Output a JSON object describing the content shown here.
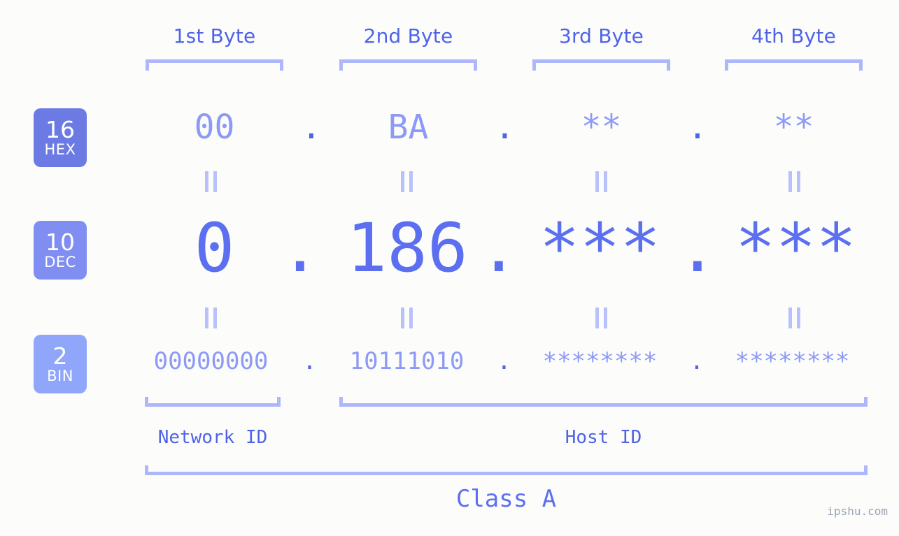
{
  "meta": {
    "background_color": "#fcfdfa",
    "accent_color": "#5c6ff0",
    "light_accent_color": "#aeb7fb"
  },
  "byte_headers": [
    {
      "label": "1st Byte"
    },
    {
      "label": "2nd Byte"
    },
    {
      "label": "3rd Byte"
    },
    {
      "label": "4th Byte"
    }
  ],
  "bases": [
    {
      "number": "16",
      "name": "HEX",
      "color": "#6c7ae3"
    },
    {
      "number": "10",
      "name": "DEC",
      "color": "#808ef2"
    },
    {
      "number": "2",
      "name": "BIN",
      "color": "#8fa6fb"
    }
  ],
  "rows": {
    "hex": {
      "base_number": "16",
      "base_name": "HEX",
      "values": [
        "00",
        "BA",
        "**",
        "**"
      ],
      "separator": "."
    },
    "dec": {
      "base_number": "10",
      "base_name": "DEC",
      "values": [
        "0",
        "186",
        "***",
        "***"
      ],
      "separator": "."
    },
    "bin": {
      "base_number": "2",
      "base_name": "BIN",
      "values": [
        "00000000",
        "10111010",
        "********",
        "********"
      ],
      "separator": "."
    }
  },
  "equals_mark": "||",
  "sections": [
    {
      "label": "Network ID"
    },
    {
      "label": "Host ID"
    }
  ],
  "class": {
    "label": "Class A"
  },
  "watermark": {
    "text": "ipshu.com"
  }
}
